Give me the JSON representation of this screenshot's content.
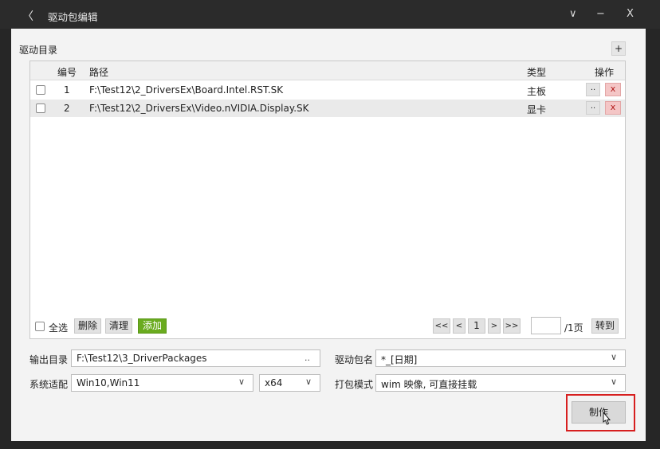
{
  "window": {
    "title": "驱动包编辑",
    "back_glyph": "〈",
    "controls": {
      "collapse": "∨",
      "minimize": "−",
      "close": "X"
    }
  },
  "catalog": {
    "label": "驱动目录",
    "add_glyph": "+",
    "headers": {
      "index": "编号",
      "path": "路径",
      "type": "类型",
      "actions": "操作"
    },
    "rows": [
      {
        "index": "1",
        "path": "F:\\Test12\\2_DriversEx\\Board.Intel.RST.SK",
        "type": "主板",
        "browse": "..",
        "remove": "x"
      },
      {
        "index": "2",
        "path": "F:\\Test12\\2_DriversEx\\Video.nVIDIA.Display.SK",
        "type": "显卡",
        "browse": "..",
        "remove": "x"
      }
    ]
  },
  "list_toolbar": {
    "select_all": "全选",
    "delete": "删除",
    "clear": "清理",
    "add": "添加"
  },
  "pager": {
    "first": "<<",
    "prev": "<",
    "current": "1",
    "next": ">",
    "last": ">>",
    "input_value": "",
    "total": "/1页",
    "goto": "转到"
  },
  "form": {
    "output_dir_label": "输出目录",
    "output_dir_value": "F:\\Test12\\3_DriverPackages",
    "output_dir_browse": "..",
    "package_name_label": "驱动包名",
    "package_name_value": "*_[日期]",
    "system_label": "系统适配",
    "system_value": "Win10,Win11",
    "arch_value": "x64",
    "pack_mode_label": "打包模式",
    "pack_mode_value": "wim 映像, 可直接挂载",
    "chevron": "∨"
  },
  "actions": {
    "make": "制作"
  },
  "colors": {
    "accent_green": "#6aab1f",
    "delete_red": "#f4c6c6",
    "highlight_red": "#d71f1f"
  }
}
